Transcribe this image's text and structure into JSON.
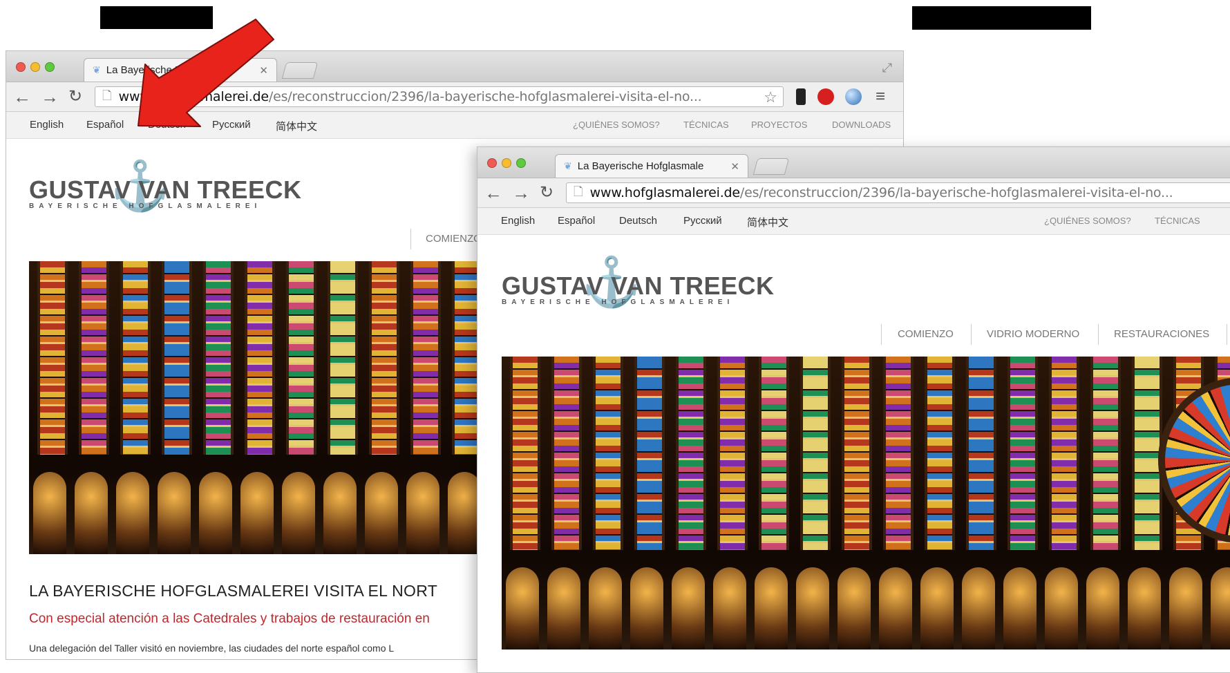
{
  "tab_title": "La Bayerische Hofglasmale",
  "url": {
    "host": "www.hofglasmalerei.de",
    "path": "/es/reconstruccion/2396/la-bayerische-hofglasmalerei-visita-el-no..."
  },
  "languages": [
    "English",
    "Español",
    "Deutsch",
    "Русский",
    "简体中文"
  ],
  "top_nav": [
    "¿QUIÉNES SOMOS?",
    "TÉCNICAS",
    "PROYECTOS",
    "DOWNLOADS"
  ],
  "logo": {
    "name": "GUSTAV VAN TREECK",
    "tagline": "BAYERISCHE HOFGLASMALEREI"
  },
  "main_menu": [
    "COMIENZO",
    "VIDRIO MODERNO",
    "RESTAURACIONES"
  ],
  "article": {
    "heading": "LA BAYERISCHE HOFGLASMALEREI VISITA EL NORT",
    "subheading": "Con especial atención a las Catedrales y trabajos de restauración en",
    "body": "Una delegación del Taller visitó en noviembre, las ciudades del norte español como L"
  },
  "icons": {
    "back": "arrow-left-icon",
    "forward": "arrow-right-icon",
    "reload": "reload-icon",
    "page": "page-icon",
    "bookmark": "star-icon",
    "menu": "hamburger-icon",
    "annotation": "red-arrow-icon"
  },
  "colors": {
    "accent_red": "#c0272d",
    "arrow_red": "#e8231c",
    "logo_gray": "#555555"
  }
}
